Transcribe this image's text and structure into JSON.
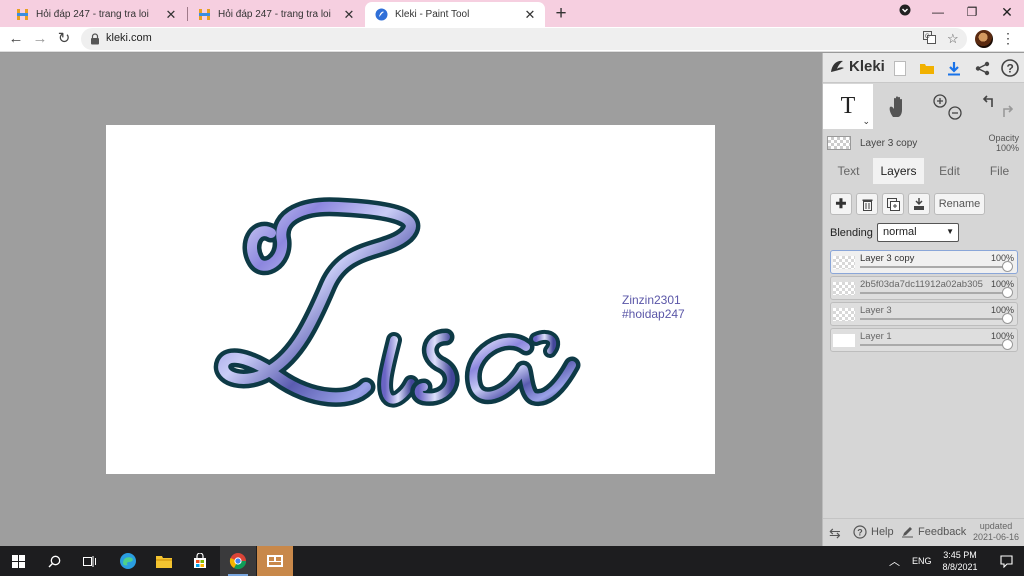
{
  "browser": {
    "tabs": [
      {
        "title": "Hỏi đáp 247 - trang tra loi",
        "icon": "hoidap-favicon",
        "active": false
      },
      {
        "title": "Hỏi đáp 247 - trang tra loi",
        "icon": "hoidap-favicon",
        "active": false
      },
      {
        "title": "Kleki - Paint Tool",
        "icon": "kleki-favicon",
        "active": true
      }
    ],
    "url": "kleki.com"
  },
  "canvas": {
    "watermark_line1": "Zinzin2301",
    "watermark_line2": "#hoidap247"
  },
  "panel": {
    "brand": "Kleki",
    "current_layer": "Layer 3 copy",
    "opacity_label": "Opacity",
    "opacity_value": "100%",
    "tabs": [
      "Text",
      "Layers",
      "Edit",
      "File"
    ],
    "active_tab": "Layers",
    "rename_label": "Rename",
    "blending_label": "Blending",
    "blending_value": "normal",
    "layers": [
      {
        "name": "Layer 3 copy",
        "opacity": "100%",
        "active": true
      },
      {
        "name": "2b5f03da7dc11912a02ab305",
        "opacity": "100%",
        "active": false
      },
      {
        "name": "Layer 3",
        "opacity": "100%",
        "active": false
      },
      {
        "name": "Layer 1",
        "opacity": "100%",
        "active": false
      }
    ],
    "footer": {
      "help": "Help",
      "feedback": "Feedback",
      "updated_label": "updated",
      "updated_date": "2021-06-16"
    }
  },
  "taskbar": {
    "language": "ENG",
    "time": "3:45 PM",
    "date": "8/8/2021"
  },
  "colors": {
    "tab_strip": "#f6cfe0",
    "letter_outline": "#0e3a46",
    "watermark": "#5b57a8",
    "accent_blue": "#1a73e8"
  }
}
